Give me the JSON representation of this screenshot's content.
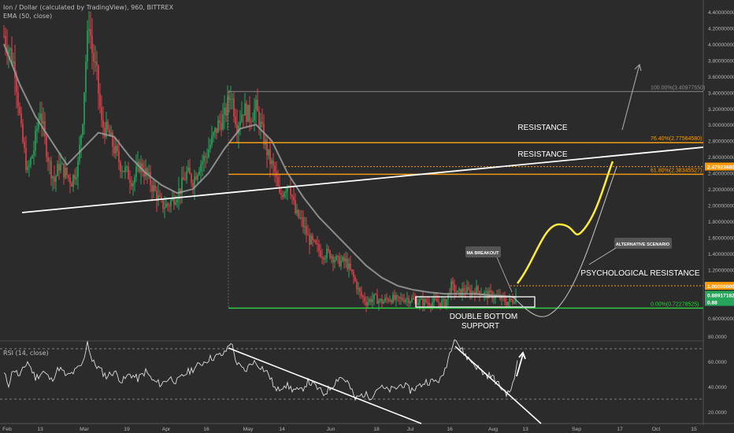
{
  "header": {
    "symbol_line": "Ion / Dollar (calculated by TradingView), 960, BITTREX",
    "indicator_line": "EMA (50, close)"
  },
  "rsi_header": "RSI (14, close)",
  "colors": {
    "background": "#2b2b2b",
    "candle_up": "#26a65b",
    "candle_down": "#e0424b",
    "ema": "#9e9e9e",
    "resistance": "#f39c12",
    "support": "#2ecc40",
    "projection": "#ffeb3b",
    "trendline": "#ffffff",
    "price_badge": "#ff9800",
    "last_badge": "#26a65b"
  },
  "chart_data": [
    {
      "type": "candlestick",
      "title": "Ion / Dollar (calculated by TradingView), 960, BITTREX",
      "indicator": "EMA (50, close)",
      "x_ticks": [
        "Feb",
        "13",
        "Mar",
        "19",
        "Apr",
        "16",
        "May",
        "14",
        "Jun",
        "18",
        "Jul",
        "16",
        "Aug",
        "13",
        "Sep",
        "17",
        "Oct",
        "15"
      ],
      "y_ticks": [
        "0.60000000",
        "0.80000000",
        "1.00000000",
        "1.20000000",
        "1.40000000",
        "1.60000000",
        "1.80000000",
        "2.00000000",
        "2.20000000",
        "2.40000000",
        "2.60000000",
        "2.80000000",
        "3.00000000",
        "3.20000000",
        "3.40000000",
        "3.60000000",
        "3.80000000",
        "4.00000000",
        "4.20000000",
        "4.40000000"
      ],
      "ylim": [
        0.5,
        4.45
      ],
      "price_anchors": [
        [
          0,
          4.1
        ],
        [
          8,
          3.9
        ],
        [
          14,
          3.7
        ],
        [
          22,
          2.9
        ],
        [
          30,
          2.4
        ],
        [
          38,
          2.7
        ],
        [
          46,
          3.2
        ],
        [
          52,
          2.8
        ],
        [
          58,
          2.5
        ],
        [
          64,
          2.3
        ],
        [
          70,
          2.5
        ],
        [
          78,
          2.4
        ],
        [
          86,
          2.3
        ],
        [
          94,
          2.5
        ],
        [
          100,
          3.1
        ],
        [
          104,
          3.8
        ],
        [
          108,
          4.3
        ],
        [
          112,
          3.9
        ],
        [
          118,
          3.6
        ],
        [
          124,
          3.0
        ],
        [
          132,
          2.9
        ],
        [
          140,
          2.7
        ],
        [
          148,
          2.5
        ],
        [
          156,
          2.4
        ],
        [
          164,
          2.3
        ],
        [
          172,
          2.5
        ],
        [
          180,
          2.4
        ],
        [
          190,
          2.2
        ],
        [
          200,
          2.0
        ],
        [
          208,
          2.0
        ],
        [
          216,
          2.1
        ],
        [
          224,
          2.2
        ],
        [
          232,
          2.4
        ],
        [
          240,
          2.3
        ],
        [
          248,
          2.5
        ],
        [
          256,
          2.6
        ],
        [
          264,
          2.8
        ],
        [
          272,
          3.0
        ],
        [
          280,
          3.1
        ],
        [
          288,
          3.4
        ],
        [
          296,
          3.0
        ],
        [
          304,
          3.2
        ],
        [
          312,
          3.1
        ],
        [
          320,
          3.2
        ],
        [
          328,
          2.9
        ],
        [
          336,
          2.6
        ],
        [
          344,
          2.4
        ],
        [
          350,
          2.1
        ],
        [
          356,
          2.2
        ],
        [
          362,
          2.3
        ],
        [
          370,
          1.9
        ],
        [
          378,
          1.8
        ],
        [
          386,
          1.6
        ],
        [
          394,
          1.5
        ],
        [
          404,
          1.4
        ],
        [
          414,
          1.4
        ],
        [
          424,
          1.3
        ],
        [
          434,
          1.3
        ],
        [
          444,
          1.1
        ],
        [
          452,
          0.9
        ],
        [
          460,
          0.8
        ],
        [
          470,
          0.85
        ],
        [
          480,
          0.8
        ],
        [
          490,
          0.85
        ],
        [
          500,
          0.82
        ],
        [
          510,
          0.85
        ],
        [
          520,
          0.82
        ],
        [
          530,
          0.8
        ],
        [
          540,
          0.8
        ],
        [
          550,
          0.8
        ],
        [
          560,
          0.78
        ],
        [
          568,
          1.0
        ],
        [
          576,
          0.9
        ],
        [
          584,
          0.95
        ],
        [
          592,
          0.92
        ],
        [
          600,
          0.95
        ],
        [
          610,
          0.9
        ],
        [
          620,
          0.88
        ],
        [
          630,
          0.85
        ],
        [
          638,
          0.8
        ],
        [
          646,
          0.82
        ],
        [
          650,
          0.88
        ]
      ],
      "ema_anchors": [
        [
          0,
          4.0
        ],
        [
          20,
          3.5
        ],
        [
          40,
          3.1
        ],
        [
          60,
          2.8
        ],
        [
          80,
          2.5
        ],
        [
          100,
          2.7
        ],
        [
          120,
          2.9
        ],
        [
          140,
          2.85
        ],
        [
          160,
          2.6
        ],
        [
          180,
          2.4
        ],
        [
          200,
          2.25
        ],
        [
          220,
          2.15
        ],
        [
          240,
          2.2
        ],
        [
          260,
          2.4
        ],
        [
          280,
          2.7
        ],
        [
          300,
          2.95
        ],
        [
          320,
          3.0
        ],
        [
          340,
          2.8
        ],
        [
          360,
          2.4
        ],
        [
          380,
          2.1
        ],
        [
          400,
          1.85
        ],
        [
          420,
          1.65
        ],
        [
          440,
          1.45
        ],
        [
          460,
          1.25
        ],
        [
          480,
          1.1
        ],
        [
          500,
          1.0
        ],
        [
          520,
          0.95
        ],
        [
          540,
          0.92
        ],
        [
          560,
          0.9
        ],
        [
          580,
          0.9
        ],
        [
          600,
          0.9
        ],
        [
          620,
          0.88
        ],
        [
          640,
          0.87
        ],
        [
          650,
          0.86
        ]
      ],
      "horizontal_levels": [
        {
          "label": "100.00%(3.40977550)",
          "value": 3.4097755,
          "x_start": 290
        },
        {
          "label": "76.40%(2.77564580)",
          "value": 2.7756458,
          "x_start": 290
        },
        {
          "label": "61.80%(2.38345527)",
          "value": 2.38345527,
          "x_start": 290
        },
        {
          "label": "0.00%(0.72278525)",
          "value": 0.72278525,
          "x_start": 290
        }
      ],
      "dotted_levels": [
        {
          "value": 2.4792368,
          "x_start": 362
        },
        {
          "value": 1.0,
          "x_start": 648
        }
      ],
      "price_badges": [
        "2.47923680",
        "1.00000000",
        "0.88917182",
        "0.88"
      ],
      "annotations": {
        "resistance_1": "RESISTANCE",
        "resistance_2": "RESISTANCE",
        "psychological": "PSYCHOLOGICAL RESISTANCE",
        "double_bottom_1": "DOUBLE BOTTOM",
        "double_bottom_2": "SUPPORT",
        "ma_breakout": "MA BREAKOUT",
        "alt_scenario": "ALTERNATIVE SCENARIO"
      }
    },
    {
      "type": "line",
      "title": "RSI (14, close)",
      "y_ticks": [
        "20.0000",
        "40.0000",
        "60.0000",
        "80.0000"
      ],
      "ylim": [
        14,
        84
      ],
      "guide_levels": [
        70,
        30
      ],
      "rsi_anchors": [
        [
          0,
          50
        ],
        [
          6,
          42
        ],
        [
          12,
          54
        ],
        [
          20,
          48
        ],
        [
          30,
          60
        ],
        [
          40,
          47
        ],
        [
          50,
          52
        ],
        [
          60,
          45
        ],
        [
          70,
          55
        ],
        [
          80,
          48
        ],
        [
          90,
          52
        ],
        [
          100,
          58
        ],
        [
          106,
          76
        ],
        [
          112,
          60
        ],
        [
          120,
          55
        ],
        [
          130,
          48
        ],
        [
          140,
          52
        ],
        [
          150,
          44
        ],
        [
          160,
          50
        ],
        [
          170,
          46
        ],
        [
          180,
          52
        ],
        [
          190,
          44
        ],
        [
          200,
          42
        ],
        [
          210,
          47
        ],
        [
          220,
          44
        ],
        [
          230,
          50
        ],
        [
          240,
          54
        ],
        [
          250,
          58
        ],
        [
          260,
          62
        ],
        [
          270,
          64
        ],
        [
          280,
          66
        ],
        [
          288,
          76
        ],
        [
          296,
          58
        ],
        [
          306,
          52
        ],
        [
          316,
          60
        ],
        [
          326,
          56
        ],
        [
          336,
          50
        ],
        [
          346,
          36
        ],
        [
          356,
          42
        ],
        [
          366,
          38
        ],
        [
          376,
          36
        ],
        [
          386,
          44
        ],
        [
          396,
          40
        ],
        [
          406,
          34
        ],
        [
          416,
          40
        ],
        [
          426,
          48
        ],
        [
          436,
          44
        ],
        [
          446,
          30
        ],
        [
          456,
          34
        ],
        [
          466,
          32
        ],
        [
          476,
          40
        ],
        [
          486,
          37
        ],
        [
          496,
          38
        ],
        [
          506,
          42
        ],
        [
          516,
          37
        ],
        [
          526,
          40
        ],
        [
          536,
          44
        ],
        [
          546,
          44
        ],
        [
          556,
          46
        ],
        [
          564,
          62
        ],
        [
          572,
          80
        ],
        [
          580,
          70
        ],
        [
          590,
          62
        ],
        [
          600,
          56
        ],
        [
          610,
          50
        ],
        [
          620,
          48
        ],
        [
          630,
          40
        ],
        [
          640,
          34
        ],
        [
          648,
          44
        ],
        [
          652,
          62
        ]
      ]
    }
  ]
}
